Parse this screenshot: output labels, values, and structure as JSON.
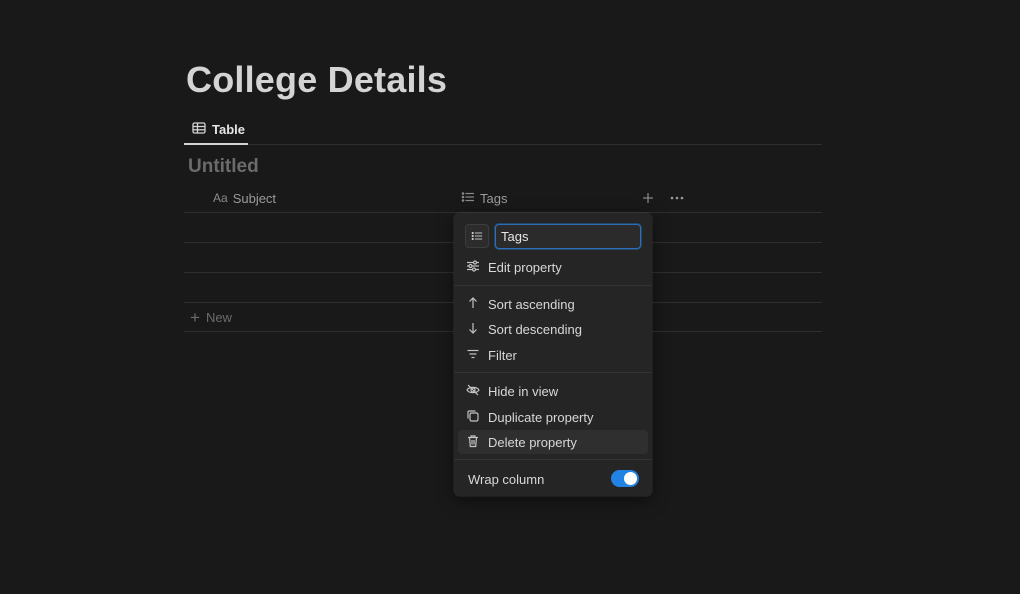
{
  "page": {
    "title": "College Details"
  },
  "views": {
    "active_tab": "Table"
  },
  "database": {
    "title": "Untitled",
    "columns": [
      {
        "name": "Subject",
        "icon": "text-aa-icon"
      },
      {
        "name": "Tags",
        "icon": "list-icon"
      }
    ],
    "new_label": "New"
  },
  "menu": {
    "property_name": "Tags",
    "items": [
      {
        "label": "Edit property",
        "icon": "sliders-icon"
      },
      {
        "label": "Sort ascending",
        "icon": "arrow-up-icon"
      },
      {
        "label": "Sort descending",
        "icon": "arrow-down-icon"
      },
      {
        "label": "Filter",
        "icon": "filter-icon"
      },
      {
        "label": "Hide in view",
        "icon": "eye-slash-icon"
      },
      {
        "label": "Duplicate property",
        "icon": "duplicate-icon"
      },
      {
        "label": "Delete property",
        "icon": "trash-icon"
      }
    ],
    "wrap_label": "Wrap column",
    "wrap_on": true
  },
  "colors": {
    "background": "#191919",
    "accent": "#2383e2"
  }
}
